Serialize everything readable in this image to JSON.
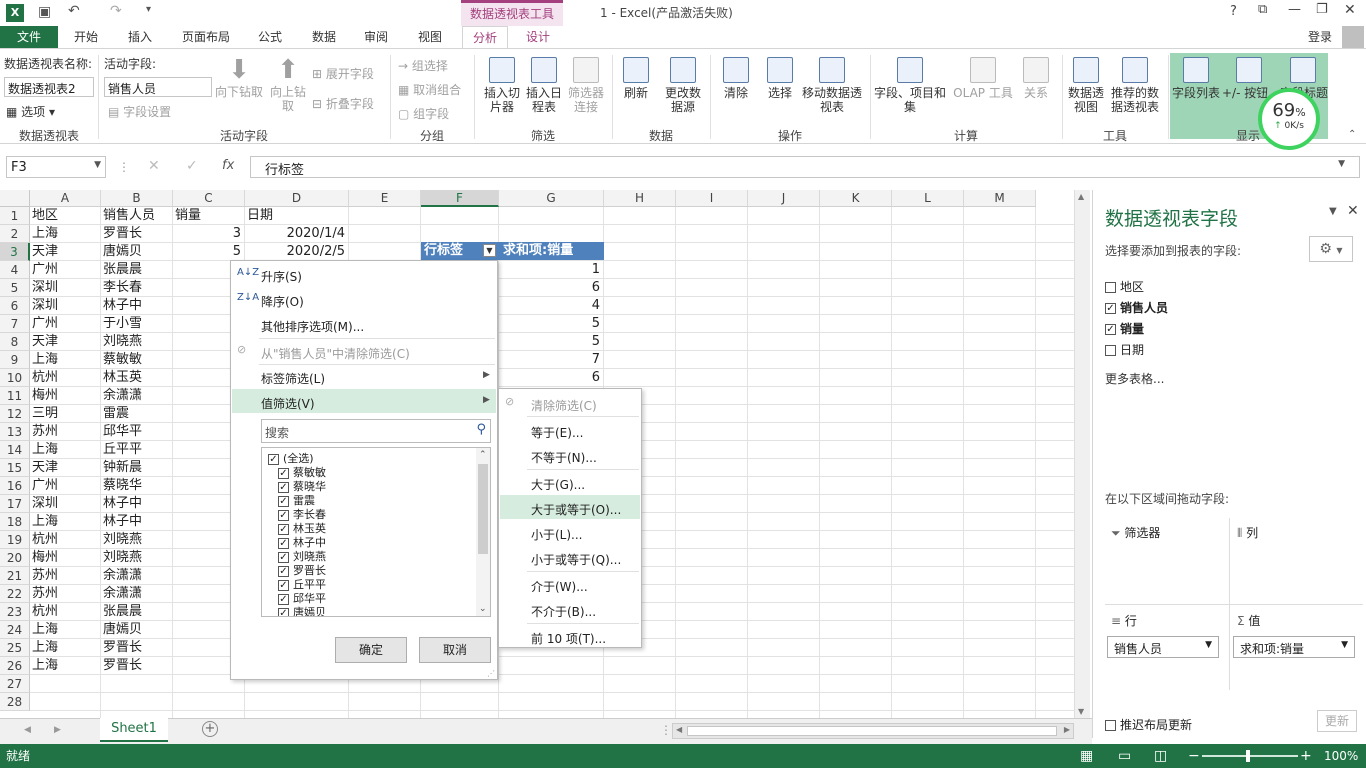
{
  "window": {
    "title": "1 - Excel(产品激活失败)",
    "context_tab": "数据透视表工具",
    "help": "?",
    "user": "登录"
  },
  "ribbon_tabs": [
    "文件",
    "开始",
    "插入",
    "页面布局",
    "公式",
    "数据",
    "审阅",
    "视图",
    "分析",
    "设计"
  ],
  "ribbon": {
    "pivot_name_label": "数据透视表名称:",
    "pivot_name_value": "数据透视表2",
    "options_label": "选项",
    "active_field_label": "活动字段:",
    "active_field_value": "销售人员",
    "field_settings": "字段设置",
    "drill_down": "向下钻取",
    "drill_up": "向上钻取",
    "expand_field": "展开字段",
    "collapse_field": "折叠字段",
    "group_selection": "组选择",
    "ungroup": "取消组合",
    "group_field": "组字段",
    "insert_slicer": "插入切片器",
    "insert_timeline": "插入日程表",
    "filter_connections": "筛选器连接",
    "refresh": "刷新",
    "change_source": "更改数据源",
    "clear": "清除",
    "select": "选择",
    "move_pivot": "移动数据透视表",
    "fields_items_sets": "字段、项目和集",
    "olap_tools": "OLAP 工具",
    "relationships": "关系",
    "pivot_chart": "数据透视图",
    "recommended_pivot": "推荐的数据透视表",
    "field_list": "字段列表",
    "plus_minus": "+/- 按钮",
    "field_headers": "字段标题",
    "groups": [
      "数据透视表",
      "活动字段",
      "分组",
      "筛选",
      "数据",
      "操作",
      "计算",
      "工具",
      "显示"
    ]
  },
  "net_meter": {
    "percent": "69",
    "unit": "%",
    "speed": "0K/s"
  },
  "formula_bar": {
    "namebox": "F3",
    "fx": "fx",
    "content": "行标签"
  },
  "columns": [
    "A",
    "B",
    "C",
    "D",
    "E",
    "F",
    "G",
    "H",
    "I",
    "J",
    "K",
    "L",
    "M"
  ],
  "rows": [
    [
      "地区",
      "销售人员",
      "销量",
      "日期"
    ],
    [
      "上海",
      "罗晋长",
      "3",
      "2020/1/4"
    ],
    [
      "天津",
      "唐嫣贝",
      "5",
      "2020/2/5"
    ],
    [
      "广州",
      "张晨晨",
      "",
      ""
    ],
    [
      "深圳",
      "李长春",
      "",
      ""
    ],
    [
      "深圳",
      "林子中",
      "",
      ""
    ],
    [
      "广州",
      "于小雪",
      "",
      ""
    ],
    [
      "天津",
      "刘晓燕",
      "",
      ""
    ],
    [
      "上海",
      "蔡敏敏",
      "",
      ""
    ],
    [
      "杭州",
      "林玉英",
      "",
      ""
    ],
    [
      "梅州",
      "余潇潇",
      "",
      ""
    ],
    [
      "三明",
      "雷震",
      "",
      ""
    ],
    [
      "苏州",
      "邱华平",
      "",
      ""
    ],
    [
      "上海",
      "丘平平",
      "",
      ""
    ],
    [
      "天津",
      "钟新晨",
      "",
      ""
    ],
    [
      "广州",
      "蔡晓华",
      "",
      ""
    ],
    [
      "深圳",
      "林子中",
      "",
      ""
    ],
    [
      "上海",
      "林子中",
      "",
      ""
    ],
    [
      "杭州",
      "刘晓燕",
      "",
      ""
    ],
    [
      "梅州",
      "刘晓燕",
      "",
      ""
    ],
    [
      "苏州",
      "余潇潇",
      "",
      ""
    ],
    [
      "苏州",
      "余潇潇",
      "",
      ""
    ],
    [
      "杭州",
      "张晨晨",
      "",
      ""
    ],
    [
      "上海",
      "唐嫣贝",
      "",
      ""
    ],
    [
      "上海",
      "罗晋长",
      "",
      ""
    ],
    [
      "上海",
      "罗晋长",
      "",
      ""
    ]
  ],
  "row_numbers": [
    "1",
    "2",
    "3",
    "4",
    "5",
    "6",
    "7",
    "8",
    "9",
    "10",
    "11",
    "12",
    "13",
    "14",
    "15",
    "16",
    "17",
    "18",
    "19",
    "20",
    "21",
    "22",
    "23",
    "24",
    "25",
    "26",
    "27",
    "28"
  ],
  "pivot": {
    "row_label": "行标签",
    "sum_label": "求和项:销量",
    "values": [
      "1",
      "6",
      "4",
      "5",
      "5",
      "7",
      "6"
    ]
  },
  "menu": {
    "sort_asc": "升序(S)",
    "sort_desc": "降序(O)",
    "more_sort": "其他排序选项(M)...",
    "clear_filter": "从\"销售人员\"中清除筛选(C)",
    "label_filter": "标签筛选(L)",
    "value_filter": "值筛选(V)",
    "search_placeholder": "搜索",
    "items": [
      "(全选)",
      "蔡敏敏",
      "蔡晓华",
      "雷震",
      "李长春",
      "林玉英",
      "林子中",
      "刘晓燕",
      "罗晋长",
      "丘平平",
      "邱华平",
      "唐嫣贝"
    ],
    "ok": "确定",
    "cancel": "取消"
  },
  "submenu": [
    "清除筛选(C)",
    "等于(E)...",
    "不等于(N)...",
    "大于(G)...",
    "大于或等于(O)...",
    "小于(L)...",
    "小于或等于(Q)...",
    "介于(W)...",
    "不介于(B)...",
    "前 10 项(T)..."
  ],
  "pane": {
    "title": "数据透视表字段",
    "subtitle": "选择要添加到报表的字段:",
    "fields": [
      {
        "name": "地区",
        "checked": false
      },
      {
        "name": "销售人员",
        "checked": true
      },
      {
        "name": "销量",
        "checked": true
      },
      {
        "name": "日期",
        "checked": false
      }
    ],
    "more_tables": "更多表格...",
    "drag_label": "在以下区域间拖动字段:",
    "filters": "筛选器",
    "columns": "列",
    "rows": "行",
    "values": "值",
    "row_field": "销售人员",
    "value_field": "求和项:销量",
    "defer_update": "推迟布局更新",
    "update": "更新"
  },
  "sheet_tab": "Sheet1",
  "status": {
    "ready": "就绪",
    "zoom": "100%"
  }
}
